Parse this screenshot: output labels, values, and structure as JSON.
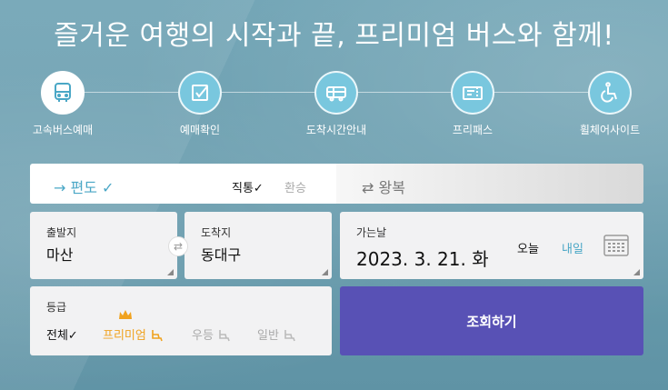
{
  "headline": "즐거운 여행의 시작과 끝, 프리미엄 버스와 함께!",
  "nav": [
    {
      "label": "고속버스예매",
      "icon": "bus-icon"
    },
    {
      "label": "예매확인",
      "icon": "checkbox-icon"
    },
    {
      "label": "도착시간안내",
      "icon": "bus-schedule-icon"
    },
    {
      "label": "프리패스",
      "icon": "ticket-icon"
    },
    {
      "label": "휠체어사이트",
      "icon": "wheelchair-icon"
    }
  ],
  "trip": {
    "oneway": "→ 편도 ✓",
    "direct": "직통✓",
    "transfer": "환승",
    "roundtrip": "⇄ 왕복"
  },
  "departure": {
    "label": "출발지",
    "value": "마산"
  },
  "arrival": {
    "label": "도착지",
    "value": "동대구"
  },
  "date": {
    "label": "가는날",
    "value": "2023. 3. 21. 화",
    "today": "오늘",
    "tomorrow": "내일"
  },
  "grade": {
    "label": "등급",
    "all": "전체✓",
    "premium": "프리미엄",
    "superior": "우등",
    "normal": "일반"
  },
  "search_button": "조회하기",
  "colors": {
    "accent": "#4aa7c6",
    "premium": "#f0a21e",
    "button": "#5851b5"
  }
}
